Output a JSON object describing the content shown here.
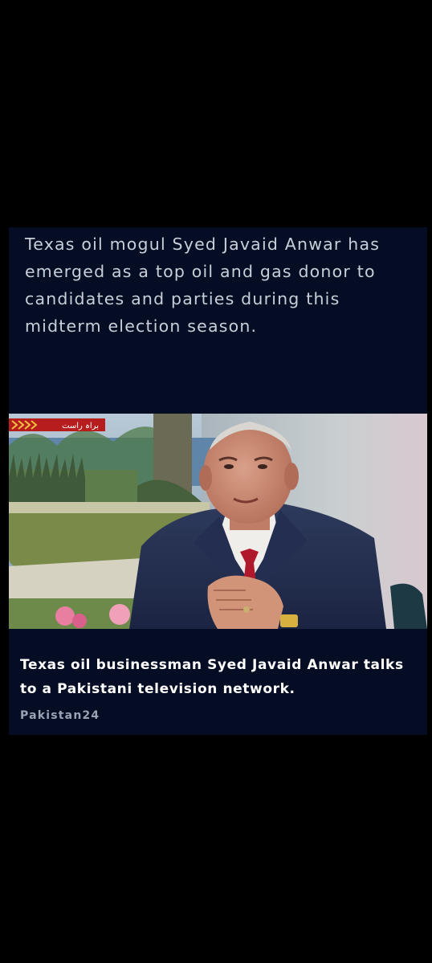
{
  "article": {
    "lede": "Texas oil mogul Syed Javaid Anwar has emerged as a top oil and gas donor to candidates and parties during this midterm election season.",
    "caption": "Texas oil businessman Syed Javaid Anwar talks to a Pakistani television network.",
    "credit": "Pakistan24"
  },
  "photo": {
    "ticker_label": "براہ راست"
  },
  "colors": {
    "page_background": "#000000",
    "card_background": "#050d24",
    "lede_text": "#c9cfd9",
    "caption_text": "#ffffff",
    "credit_text": "#9aa3b3"
  }
}
